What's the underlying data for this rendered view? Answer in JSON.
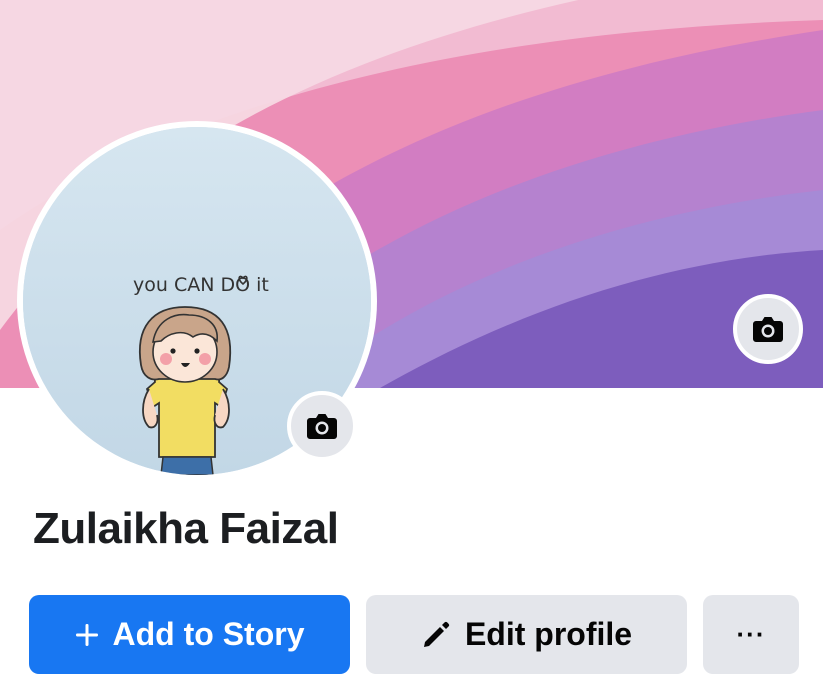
{
  "profile": {
    "name": "Zulaikha Faizal",
    "avatar_caption": "you CAN DO it"
  },
  "actions": {
    "add_story_label": "Add to Story",
    "edit_profile_label": "Edit profile",
    "more_label": "···"
  },
  "icons": {
    "cover_camera": "camera-icon",
    "avatar_camera": "camera-icon",
    "add": "plus-icon",
    "edit": "pencil-icon"
  },
  "colors": {
    "primary": "#1877f2",
    "secondary_button": "#e4e6eb",
    "name_text": "#1c1e21"
  }
}
